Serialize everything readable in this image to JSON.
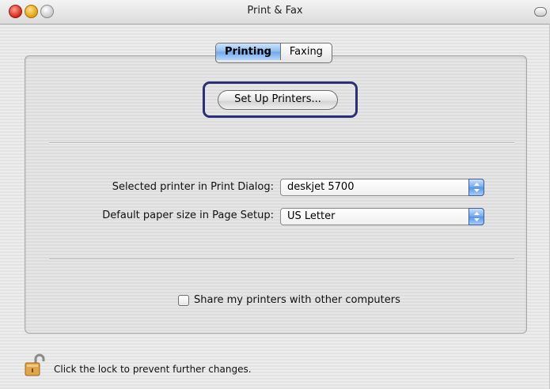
{
  "window": {
    "title": "Print & Fax"
  },
  "tabs": [
    {
      "label": "Printing",
      "selected": true
    },
    {
      "label": "Faxing",
      "selected": false
    }
  ],
  "setup_button": {
    "label": "Set Up Printers..."
  },
  "rows": {
    "selected_printer": {
      "label": "Selected printer in Print Dialog:",
      "value": "deskjet 5700"
    },
    "paper_size": {
      "label": "Default paper size in Page Setup:",
      "value": "US Letter"
    }
  },
  "share": {
    "label": "Share my printers with other computers",
    "checked": false
  },
  "lock": {
    "label": "Click the lock to prevent further changes.",
    "icon": "lock-open-icon"
  },
  "colors": {
    "accent": "#6ea8ec",
    "focus_ring": "#2c2f73"
  }
}
